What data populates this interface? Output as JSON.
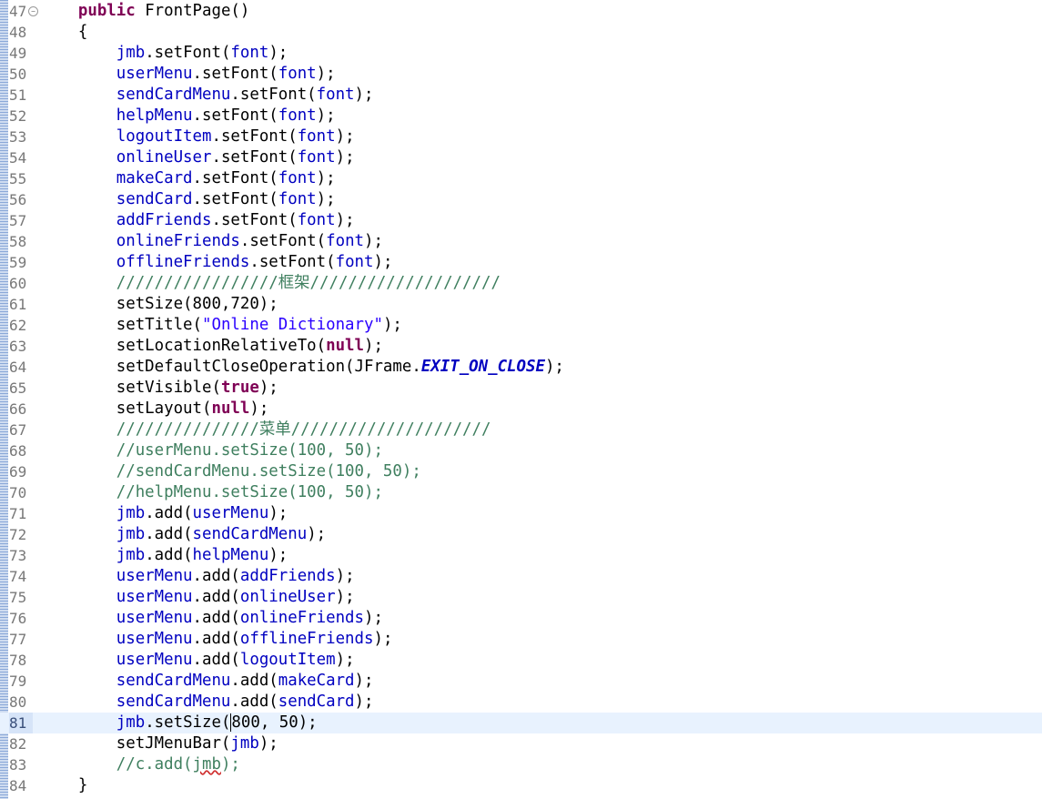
{
  "editor": {
    "current_line": 81,
    "lines": [
      {
        "n": "47",
        "fold": true,
        "t": [
          [
            "    ",
            ""
          ],
          [
            "public",
            "kw"
          ],
          [
            " FrontPage()",
            ""
          ]
        ]
      },
      {
        "n": "48",
        "t": [
          [
            "    {",
            ""
          ]
        ]
      },
      {
        "n": "49",
        "t": [
          [
            "        ",
            ""
          ],
          [
            "jmb",
            "fld"
          ],
          [
            ".setFont(",
            ""
          ],
          [
            "font",
            "fld"
          ],
          [
            ");",
            ""
          ]
        ]
      },
      {
        "n": "50",
        "t": [
          [
            "        ",
            ""
          ],
          [
            "userMenu",
            "fld"
          ],
          [
            ".setFont(",
            ""
          ],
          [
            "font",
            "fld"
          ],
          [
            ");",
            ""
          ]
        ]
      },
      {
        "n": "51",
        "t": [
          [
            "        ",
            ""
          ],
          [
            "sendCardMenu",
            "fld"
          ],
          [
            ".setFont(",
            ""
          ],
          [
            "font",
            "fld"
          ],
          [
            ");",
            ""
          ]
        ]
      },
      {
        "n": "52",
        "t": [
          [
            "        ",
            ""
          ],
          [
            "helpMenu",
            "fld"
          ],
          [
            ".setFont(",
            ""
          ],
          [
            "font",
            "fld"
          ],
          [
            ");",
            ""
          ]
        ]
      },
      {
        "n": "53",
        "t": [
          [
            "        ",
            ""
          ],
          [
            "logoutItem",
            "fld"
          ],
          [
            ".setFont(",
            ""
          ],
          [
            "font",
            "fld"
          ],
          [
            ");",
            ""
          ]
        ]
      },
      {
        "n": "54",
        "t": [
          [
            "        ",
            ""
          ],
          [
            "onlineUser",
            "fld"
          ],
          [
            ".setFont(",
            ""
          ],
          [
            "font",
            "fld"
          ],
          [
            ");",
            ""
          ]
        ]
      },
      {
        "n": "55",
        "t": [
          [
            "        ",
            ""
          ],
          [
            "makeCard",
            "fld"
          ],
          [
            ".setFont(",
            ""
          ],
          [
            "font",
            "fld"
          ],
          [
            ");",
            ""
          ]
        ]
      },
      {
        "n": "56",
        "t": [
          [
            "        ",
            ""
          ],
          [
            "sendCard",
            "fld"
          ],
          [
            ".setFont(",
            ""
          ],
          [
            "font",
            "fld"
          ],
          [
            ");",
            ""
          ]
        ]
      },
      {
        "n": "57",
        "t": [
          [
            "        ",
            ""
          ],
          [
            "addFriends",
            "fld"
          ],
          [
            ".setFont(",
            ""
          ],
          [
            "font",
            "fld"
          ],
          [
            ");",
            ""
          ]
        ]
      },
      {
        "n": "58",
        "t": [
          [
            "        ",
            ""
          ],
          [
            "onlineFriends",
            "fld"
          ],
          [
            ".setFont(",
            ""
          ],
          [
            "font",
            "fld"
          ],
          [
            ");",
            ""
          ]
        ]
      },
      {
        "n": "59",
        "t": [
          [
            "        ",
            ""
          ],
          [
            "offlineFriends",
            "fld"
          ],
          [
            ".setFont(",
            ""
          ],
          [
            "font",
            "fld"
          ],
          [
            ");",
            ""
          ]
        ]
      },
      {
        "n": "60",
        "t": [
          [
            "        ",
            ""
          ],
          [
            "/////////////////框架////////////////////",
            "cm"
          ]
        ]
      },
      {
        "n": "61",
        "t": [
          [
            "        setSize(800,720);",
            ""
          ]
        ]
      },
      {
        "n": "62",
        "t": [
          [
            "        setTitle(",
            ""
          ],
          [
            "\"Online Dictionary\"",
            "str"
          ],
          [
            ");",
            ""
          ]
        ]
      },
      {
        "n": "63",
        "t": [
          [
            "        setLocationRelativeTo(",
            ""
          ],
          [
            "null",
            "kw"
          ],
          [
            ");",
            ""
          ]
        ]
      },
      {
        "n": "64",
        "t": [
          [
            "        setDefaultCloseOperation(JFrame.",
            ""
          ],
          [
            "EXIT_ON_CLOSE",
            "cst"
          ],
          [
            ");",
            ""
          ]
        ]
      },
      {
        "n": "65",
        "t": [
          [
            "        setVisible(",
            ""
          ],
          [
            "true",
            "kw"
          ],
          [
            ");",
            ""
          ]
        ]
      },
      {
        "n": "66",
        "t": [
          [
            "        setLayout(",
            ""
          ],
          [
            "null",
            "kw"
          ],
          [
            ");",
            ""
          ]
        ]
      },
      {
        "n": "67",
        "t": [
          [
            "        ",
            ""
          ],
          [
            "///////////////菜单/////////////////////",
            "cm"
          ]
        ]
      },
      {
        "n": "68",
        "t": [
          [
            "        ",
            ""
          ],
          [
            "//userMenu.setSize(100, 50);",
            "cm"
          ]
        ]
      },
      {
        "n": "69",
        "t": [
          [
            "        ",
            ""
          ],
          [
            "//sendCardMenu.setSize(100, 50);",
            "cm"
          ]
        ]
      },
      {
        "n": "70",
        "t": [
          [
            "        ",
            ""
          ],
          [
            "//helpMenu.setSize(100, 50);",
            "cm"
          ]
        ]
      },
      {
        "n": "71",
        "t": [
          [
            "        ",
            ""
          ],
          [
            "jmb",
            "fld"
          ],
          [
            ".add(",
            ""
          ],
          [
            "userMenu",
            "fld"
          ],
          [
            ");",
            ""
          ]
        ]
      },
      {
        "n": "72",
        "t": [
          [
            "        ",
            ""
          ],
          [
            "jmb",
            "fld"
          ],
          [
            ".add(",
            ""
          ],
          [
            "sendCardMenu",
            "fld"
          ],
          [
            ");",
            ""
          ]
        ]
      },
      {
        "n": "73",
        "t": [
          [
            "        ",
            ""
          ],
          [
            "jmb",
            "fld"
          ],
          [
            ".add(",
            ""
          ],
          [
            "helpMenu",
            "fld"
          ],
          [
            ");",
            ""
          ]
        ]
      },
      {
        "n": "74",
        "t": [
          [
            "        ",
            ""
          ],
          [
            "userMenu",
            "fld"
          ],
          [
            ".add(",
            ""
          ],
          [
            "addFriends",
            "fld"
          ],
          [
            ");",
            ""
          ]
        ]
      },
      {
        "n": "75",
        "t": [
          [
            "        ",
            ""
          ],
          [
            "userMenu",
            "fld"
          ],
          [
            ".add(",
            ""
          ],
          [
            "onlineUser",
            "fld"
          ],
          [
            ");",
            ""
          ]
        ]
      },
      {
        "n": "76",
        "t": [
          [
            "        ",
            ""
          ],
          [
            "userMenu",
            "fld"
          ],
          [
            ".add(",
            ""
          ],
          [
            "onlineFriends",
            "fld"
          ],
          [
            ");",
            ""
          ]
        ]
      },
      {
        "n": "77",
        "t": [
          [
            "        ",
            ""
          ],
          [
            "userMenu",
            "fld"
          ],
          [
            ".add(",
            ""
          ],
          [
            "offlineFriends",
            "fld"
          ],
          [
            ");",
            ""
          ]
        ]
      },
      {
        "n": "78",
        "t": [
          [
            "        ",
            ""
          ],
          [
            "userMenu",
            "fld"
          ],
          [
            ".add(",
            ""
          ],
          [
            "logoutItem",
            "fld"
          ],
          [
            ");",
            ""
          ]
        ]
      },
      {
        "n": "79",
        "t": [
          [
            "        ",
            ""
          ],
          [
            "sendCardMenu",
            "fld"
          ],
          [
            ".add(",
            ""
          ],
          [
            "makeCard",
            "fld"
          ],
          [
            ");",
            ""
          ]
        ]
      },
      {
        "n": "80",
        "t": [
          [
            "        ",
            ""
          ],
          [
            "sendCardMenu",
            "fld"
          ],
          [
            ".add(",
            ""
          ],
          [
            "sendCard",
            "fld"
          ],
          [
            ");",
            ""
          ]
        ]
      },
      {
        "n": "81",
        "current": true,
        "t": [
          [
            "        ",
            ""
          ],
          [
            "jmb",
            "fld"
          ],
          [
            ".setSize(",
            ""
          ],
          [
            "800, 50);",
            "caret"
          ]
        ]
      },
      {
        "n": "82",
        "t": [
          [
            "        setJMenuBar(",
            ""
          ],
          [
            "jmb",
            "fld"
          ],
          [
            ");",
            ""
          ]
        ]
      },
      {
        "n": "83",
        "t": [
          [
            "        ",
            ""
          ],
          [
            "//c.add(",
            "cm"
          ],
          [
            "jmb",
            "cm warn"
          ],
          [
            ");",
            "cm"
          ]
        ]
      },
      {
        "n": "84",
        "t": [
          [
            "    }",
            ""
          ]
        ]
      }
    ]
  }
}
